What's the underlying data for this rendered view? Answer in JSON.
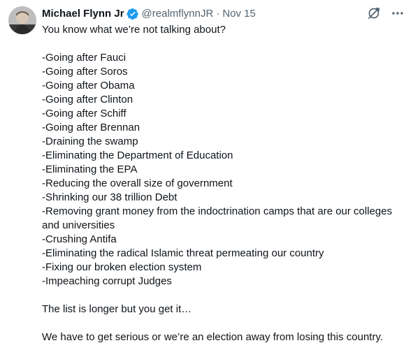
{
  "tweet": {
    "author": {
      "name": "Michael Flynn Jr",
      "handle": "@realmflynnJR",
      "verified": true,
      "avatar_icon": "profile-photo"
    },
    "separator": "·",
    "date": "Nov 15",
    "actions": {
      "grok_icon": "grok-icon",
      "more_icon": "more-icon"
    },
    "intro": "You know what we’re not talking about?",
    "items": [
      "-Going after Fauci",
      "-Going after Soros",
      "-Going after Obama",
      "-Going after Clinton",
      "-Going after Schiff",
      "-Going after Brennan",
      "-Draining the swamp",
      "-Eliminating the Department of Education",
      "-Eliminating the EPA",
      "-Reducing the overall size of government",
      "-Shrinking our 38 trillion Debt",
      "-Removing grant money from the indoctrination camps that are our colleges and universities",
      "-Crushing Antifa",
      "-Eliminating the radical Islamic threat permeating our country",
      "-Fixing our broken election system",
      "-Impeaching corrupt Judges"
    ],
    "closing_1": "The list is longer but you get it…",
    "closing_2": "We have to get serious or we’re an election away from losing this country."
  },
  "colors": {
    "text": "#0f1419",
    "secondary": "#536471",
    "verified": "#1d9bf0"
  }
}
